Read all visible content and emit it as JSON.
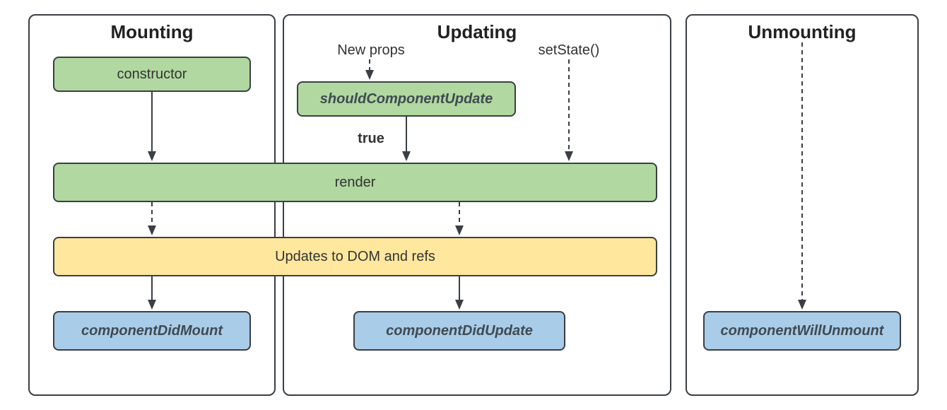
{
  "panels": {
    "mounting": {
      "title": "Mounting"
    },
    "updating": {
      "title": "Updating"
    },
    "unmounting": {
      "title": "Unmounting"
    }
  },
  "labels": {
    "new_props": "New props",
    "set_state": "setState()",
    "true": "true"
  },
  "boxes": {
    "constructor": "constructor",
    "shouldComponentUpdate": "shouldComponentUpdate",
    "render": "render",
    "updates_dom": "Updates to DOM and refs",
    "componentDidMount": "componentDidMount",
    "componentDidUpdate": "componentDidUpdate",
    "componentWillUnmount": "componentWillUnmount"
  },
  "colors": {
    "green": "#b1d8a0",
    "yellow": "#ffe79e",
    "blue": "#a9cce8",
    "border": "#3a3f44"
  }
}
